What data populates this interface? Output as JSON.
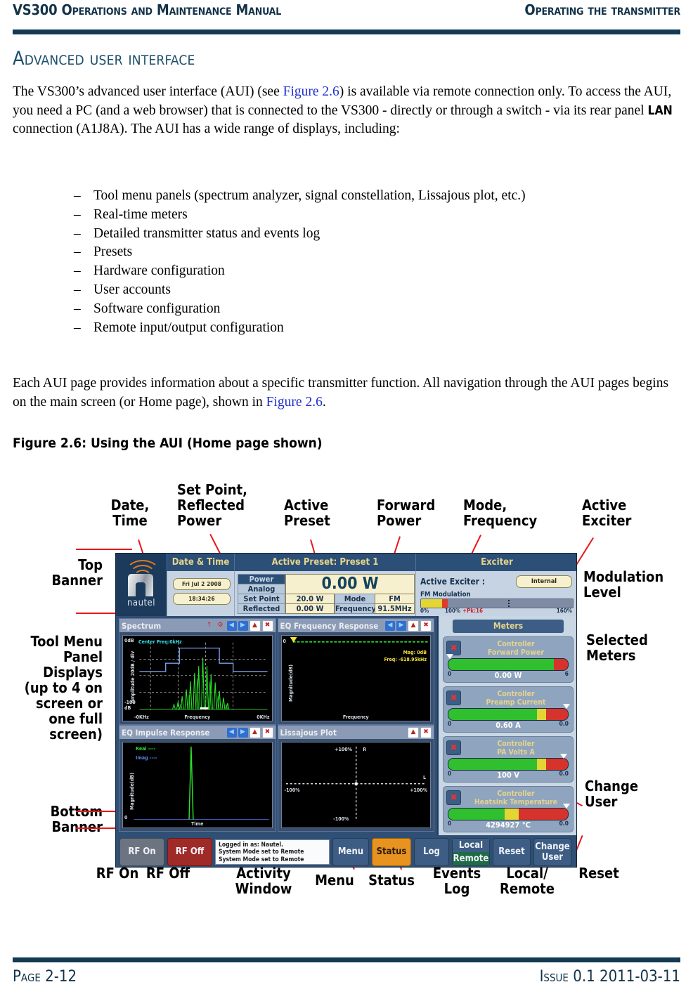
{
  "header": {
    "left": "VS300 Operations and Maintenance Manual",
    "right": "Operating the transmitter"
  },
  "section_title": "Advanced user interface",
  "paragraph1": {
    "part1": "The VS300’s advanced user interface (AUI) (see ",
    "xref1": "Figure 2.6",
    "part2": ") is available via remote connection only. To access the AUI, you need a PC (and a web browser) that is connected to the VS300 - directly or through a switch - via its rear panel ",
    "lan": "LAN",
    "part3": " connection (A1J8A). The AUI has a wide range of displays, including:"
  },
  "dash_list": {
    "mark": "–",
    "items": [
      "Tool menu panels (spectrum analyzer, signal constellation, Lissajous plot, etc.)",
      "Real-time meters",
      "Detailed transmitter status and events log",
      "Presets",
      "Hardware configuration",
      "User accounts",
      "Software configuration",
      "Remote input/output configuration"
    ]
  },
  "paragraph2": {
    "part1": "Each AUI page provides information about a specific transmitter function. All navigation through the AUI pages begins on the main screen (or Home page), shown in ",
    "xref1": "Figure 2.6",
    "part2": "."
  },
  "figure_caption": "Figure 2.6: Using the AUI (Home page shown)",
  "callouts": {
    "date_time": "Date,\nTime",
    "set_point_reflected": "Set Point,\nReflected\nPower",
    "active_preset": "Active\nPreset",
    "forward_power": "Forward\nPower",
    "mode_frequency": "Mode,\nFrequency",
    "active_exciter": "Active\nExciter",
    "top_banner": "Top\nBanner",
    "modulation_level": "Modulation\nLevel",
    "tool_menu": "Tool Menu\nPanel\nDisplays\n(up to 4 on\nscreen or\none full\nscreen)",
    "selected_meters": "Selected\nMeters",
    "bottom_banner": "Bottom\nBanner",
    "change_user": "Change\nUser",
    "rf_on": "RF On",
    "rf_off": "RF Off",
    "activity_window": "Activity\nWindow",
    "menu": "Menu",
    "status": "Status",
    "events_log": "Events\nLog",
    "local_remote": "Local/\nRemote",
    "reset": "Reset"
  },
  "aui": {
    "logo_word": "nautel",
    "date_time": {
      "header": "Date & Time",
      "date": "Fri Jul 2 2008",
      "time": "18:34:26"
    },
    "active_preset": {
      "header": "Active Preset: Preset 1",
      "power_label": "Power",
      "analog_label": "Analog",
      "big_value": "0.00 W",
      "set_point_label": "Set Point",
      "set_point_value": "20.0 W",
      "mode_label": "Mode",
      "mode_value": "FM",
      "reflected_label": "Reflected",
      "reflected_value": "0.00 W",
      "frequency_label": "Frequency",
      "frequency_value": "91.5MHz"
    },
    "exciter": {
      "header": "Exciter",
      "active_label": "Active Exciter :",
      "active_value": "Internal",
      "mod_label": "FM Modulation",
      "scale_0": "0%",
      "scale_100": "100%",
      "scale_pk": "+Pk:16",
      "scale_160": "160%"
    },
    "tools": [
      {
        "title": "Spectrum",
        "y_top": "0dB",
        "y_bottom": "-100\ndB",
        "y_axis": "Amplitude 20dB / div",
        "x_left": "-0KHz",
        "x_right": "0KHz",
        "x_axis": "Frequency",
        "annotation": "Center Freq:0kHz"
      },
      {
        "title": "EQ Frequency Response",
        "y_top": "0",
        "y_axis": "Magnitude(dB)",
        "x_axis": "Frequency",
        "annotation1": "Mag: 0dB",
        "annotation2": "Freq: -618.95kHz"
      },
      {
        "title": "EQ Impulse Response",
        "y_bottom": "0",
        "y_axis": "Magnitude(dB)",
        "x_axis": "Time",
        "legend1": "Real ----",
        "legend2": "Imag ----"
      },
      {
        "title": "Lissajous Plot",
        "top": "+100%",
        "bottom": "-100%",
        "left": "-100%",
        "right": "+100%",
        "ch_r": "R",
        "ch_l": "L"
      }
    ],
    "meters": {
      "header": "Meters",
      "close_glyph": "✖",
      "items": [
        {
          "line1": "Controller",
          "line2": "Forward Power",
          "value": "0.00 W",
          "min": "0",
          "max": "6",
          "green_pct": 88,
          "yellow_pct": 0,
          "pointer_pct": 0
        },
        {
          "line1": "Controller",
          "line2": "Preamp Current",
          "value": "0.60 A",
          "min": "0",
          "max": "0.0",
          "green_pct": 74,
          "yellow_pct": 8,
          "pointer_pct": 96
        },
        {
          "line1": "Controller",
          "line2": "PA Volts A",
          "value": "100 V",
          "min": "0",
          "max": "0.0",
          "green_pct": 74,
          "yellow_pct": 8,
          "pointer_pct": 92
        },
        {
          "line1": "Controller",
          "line2": "Heatsink Temperature",
          "value": "4294927 °C",
          "min": "0",
          "max": "0.0",
          "green_pct": 47,
          "yellow_pct": 12,
          "pointer_pct": 96
        }
      ]
    },
    "bottom_bar": {
      "rf_on": "RF On",
      "rf_off": "RF Off",
      "activity": [
        "Logged in as:     Nautel.",
        "System Mode set to Remote",
        "System Mode set to Remote"
      ],
      "menu": "Menu",
      "status": "Status",
      "log": "Log",
      "local": "Local",
      "remote": "Remote",
      "reset": "Reset",
      "change_user": "Change\nUser"
    }
  },
  "footer": {
    "left": "Page 2-12",
    "right": "Issue 0.1  2011-03-11"
  },
  "colors": {
    "accent_navy": "#123A52",
    "heading_blue": "#1C4E6B",
    "xref_blue": "#2030D0",
    "leader_red": "#E8161A",
    "aui_banner": "#1B3A5C",
    "status_orange": "#E89220",
    "rf_off_red": "#A02A28",
    "remote_green": "#1E6B46"
  }
}
